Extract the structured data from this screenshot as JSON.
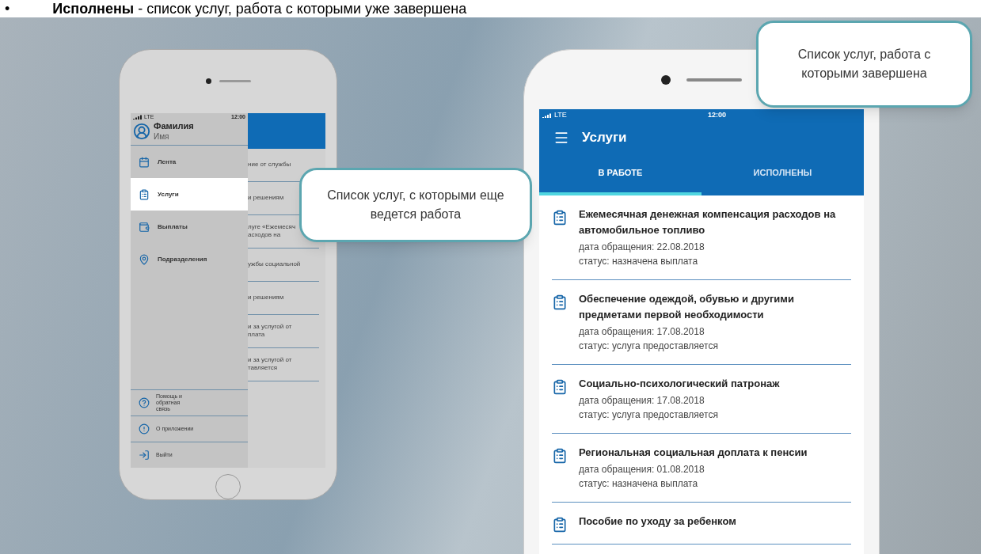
{
  "caption": {
    "bullet": "•",
    "text": "**Исполнены** - список услуг, работа с которыми уже завершена"
  },
  "left_phone": {
    "status_bar": {
      "carrier": "LTE",
      "time": "12:00"
    },
    "drawer": {
      "surname": "Фамилия",
      "name": "Имя",
      "items": [
        {
          "label": "Лента",
          "selected": false
        },
        {
          "label": "Услуги",
          "selected": true
        },
        {
          "label": "Выплаты",
          "selected": false
        },
        {
          "label": "Подразделения",
          "selected": false
        }
      ],
      "footer_items": [
        {
          "label": "Помощь и обратная связь"
        },
        {
          "label": "О приложении"
        },
        {
          "label": "Выйти"
        }
      ]
    },
    "background_rows": [
      [
        "ние от службы"
      ],
      [
        "и решениям"
      ],
      [
        "луге «Ежемесяч",
        "асходов на"
      ],
      [
        "ужбы социальной"
      ],
      [
        "и решениям"
      ],
      [
        "и за услугой от",
        "плата"
      ],
      [
        "и за услугой от",
        "тавляется"
      ]
    ]
  },
  "right_phone": {
    "status_bar": {
      "carrier": "LTE",
      "time": "12:00"
    },
    "title": "Услуги",
    "tabs": [
      {
        "label": "В РАБОТЕ",
        "selected": true
      },
      {
        "label": "ИСПОЛНЕНЫ",
        "selected": false
      }
    ],
    "services": [
      {
        "title": "Ежемесячная денежная компенсация расходов на автомобильное топливо",
        "date": "дата обращения: 22.08.2018",
        "status": "статус: назначена выплата"
      },
      {
        "title": "Обеспечение одеждой, обувью и другими предметами первой необходимости",
        "date": "дата обращения: 17.08.2018",
        "status": "статус: услуга предоставляется"
      },
      {
        "title": "Социально-психологический патронаж",
        "date": "дата обращения: 17.08.2018",
        "status": "статус: услуга предоставляется"
      },
      {
        "title": "Региональная социальная доплата к пенсии",
        "date": "дата обращения: 01.08.2018",
        "status": "статус: назначена выплата"
      },
      {
        "title": "Пособие по уходу за ребенком"
      }
    ]
  },
  "callouts": [
    {
      "text": "Список услуг, с которыми еще ведется работа"
    },
    {
      "text": "Список услуг, работа с которыми завершена"
    }
  ]
}
